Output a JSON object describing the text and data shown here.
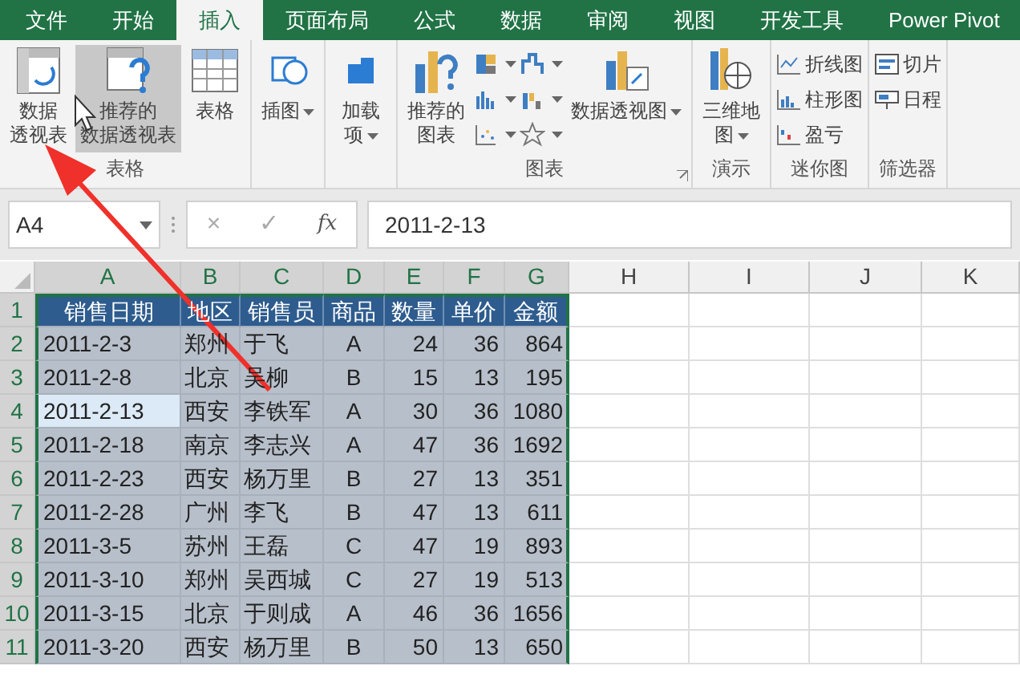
{
  "tabs": [
    {
      "label": "文件",
      "selected": false
    },
    {
      "label": "开始",
      "selected": false
    },
    {
      "label": "插入",
      "selected": true
    },
    {
      "label": "页面布局",
      "selected": false
    },
    {
      "label": "公式",
      "selected": false
    },
    {
      "label": "数据",
      "selected": false
    },
    {
      "label": "审阅",
      "selected": false
    },
    {
      "label": "视图",
      "selected": false
    },
    {
      "label": "开发工具",
      "selected": false
    },
    {
      "label": "Power Pivot",
      "selected": false
    }
  ],
  "ribbon": [
    {
      "label": "表格",
      "launcher": false,
      "items": [
        {
          "kind": "large",
          "label_lines": [
            "数据",
            "透视表"
          ],
          "hovered": false,
          "dropdown": false
        },
        {
          "kind": "large",
          "label_lines": [
            "推荐的",
            "数据透视表"
          ],
          "hovered": true,
          "dropdown": false
        },
        {
          "kind": "large",
          "label_lines": [
            "表格"
          ],
          "hovered": false,
          "dropdown": false
        }
      ]
    },
    {
      "launcher": false,
      "items": [
        {
          "kind": "large",
          "label_lines": [
            "插图"
          ],
          "hovered": false,
          "dropdown": true
        }
      ]
    },
    {
      "launcher": false,
      "items": [
        {
          "kind": "large",
          "label_lines": [
            "加载",
            "项"
          ],
          "hovered": false,
          "dropdown": true
        }
      ]
    },
    {
      "label": "图表",
      "launcher": true,
      "items": [
        {
          "kind": "large",
          "label_lines": [
            "推荐的",
            "图表"
          ],
          "hovered": false,
          "dropdown": false
        },
        {
          "kind": "icon",
          "hovered": false,
          "dropdown": true
        },
        {
          "kind": "icon",
          "hovered": false,
          "dropdown": true
        },
        {
          "kind": "icon",
          "hovered": false,
          "dropdown": true
        },
        {
          "kind": "icon",
          "hovered": false,
          "dropdown": true
        },
        {
          "kind": "icon",
          "hovered": false,
          "dropdown": true
        },
        {
          "kind": "icon",
          "hovered": false,
          "dropdown": true
        },
        {
          "kind": "large",
          "label_lines": [
            "数据透视图"
          ],
          "hovered": false,
          "dropdown": true
        }
      ]
    },
    {
      "label": "演示",
      "launcher": false,
      "items": [
        {
          "kind": "large",
          "label_lines": [
            "三维地",
            "图"
          ],
          "hovered": false,
          "dropdown": true
        }
      ]
    },
    {
      "label": "迷你图",
      "launcher": false,
      "items": [
        {
          "kind": "small",
          "label": "折线图",
          "hovered": false,
          "dropdown": false
        },
        {
          "kind": "small",
          "label": "柱形图",
          "hovered": false,
          "dropdown": false
        },
        {
          "kind": "small",
          "label": "盈亏",
          "hovered": false,
          "dropdown": false
        }
      ]
    },
    {
      "label": "筛选器",
      "launcher": false,
      "items": [
        {
          "kind": "small",
          "label": "切片",
          "hovered": false,
          "dropdown": false
        },
        {
          "kind": "small",
          "label": "日程",
          "hovered": false,
          "dropdown": false
        }
      ]
    }
  ],
  "formula_bar": {
    "name_box": "A4",
    "cancel": "×",
    "enter": "✓",
    "function": "fx",
    "formula": "2011-2-13"
  },
  "sheet": {
    "columns": [
      {
        "label": "A",
        "selected": true
      },
      {
        "label": "B",
        "selected": true
      },
      {
        "label": "C",
        "selected": true
      },
      {
        "label": "D",
        "selected": true
      },
      {
        "label": "E",
        "selected": true
      },
      {
        "label": "F",
        "selected": true
      },
      {
        "label": "G",
        "selected": true
      },
      {
        "label": "H",
        "selected": false
      },
      {
        "label": "I",
        "selected": false
      },
      {
        "label": "J",
        "selected": false
      },
      {
        "label": "K",
        "selected": false
      }
    ],
    "rows": [
      {
        "number": "1",
        "kind": "header",
        "selected": true,
        "active": false,
        "cells": [
          "销售日期",
          "地区",
          "销售员",
          "商品",
          "数量",
          "单价",
          "金额"
        ]
      },
      {
        "number": "2",
        "kind": "data",
        "selected": true,
        "active": false,
        "cells": [
          "2011-2-3",
          "郑州",
          "于飞",
          "A",
          "24",
          "36",
          "864"
        ]
      },
      {
        "number": "3",
        "kind": "data",
        "selected": true,
        "active": false,
        "cells": [
          "2011-2-8",
          "北京",
          "吴柳",
          "B",
          "15",
          "13",
          "195"
        ]
      },
      {
        "number": "4",
        "kind": "data",
        "selected": true,
        "active": true,
        "cells": [
          "2011-2-13",
          "西安",
          "李铁军",
          "A",
          "30",
          "36",
          "1080"
        ]
      },
      {
        "number": "5",
        "kind": "data",
        "selected": true,
        "active": false,
        "cells": [
          "2011-2-18",
          "南京",
          "李志兴",
          "A",
          "47",
          "36",
          "1692"
        ]
      },
      {
        "number": "6",
        "kind": "data",
        "selected": true,
        "active": false,
        "cells": [
          "2011-2-23",
          "西安",
          "杨万里",
          "B",
          "27",
          "13",
          "351"
        ]
      },
      {
        "number": "7",
        "kind": "data",
        "selected": true,
        "active": false,
        "cells": [
          "2011-2-28",
          "广州",
          "李飞",
          "B",
          "47",
          "13",
          "611"
        ]
      },
      {
        "number": "8",
        "kind": "data",
        "selected": true,
        "active": false,
        "cells": [
          "2011-3-5",
          "苏州",
          "王磊",
          "C",
          "47",
          "19",
          "893"
        ]
      },
      {
        "number": "9",
        "kind": "data",
        "selected": true,
        "active": false,
        "cells": [
          "2011-3-10",
          "郑州",
          "吴西城",
          "C",
          "27",
          "19",
          "513"
        ]
      },
      {
        "number": "10",
        "kind": "data",
        "selected": true,
        "active": false,
        "cells": [
          "2011-3-15",
          "北京",
          "于则成",
          "A",
          "46",
          "36",
          "1656"
        ]
      },
      {
        "number": "11",
        "kind": "data",
        "selected": true,
        "active": false,
        "cells": [
          "2011-3-20",
          "西安",
          "杨万里",
          "B",
          "50",
          "13",
          "650"
        ]
      }
    ]
  }
}
